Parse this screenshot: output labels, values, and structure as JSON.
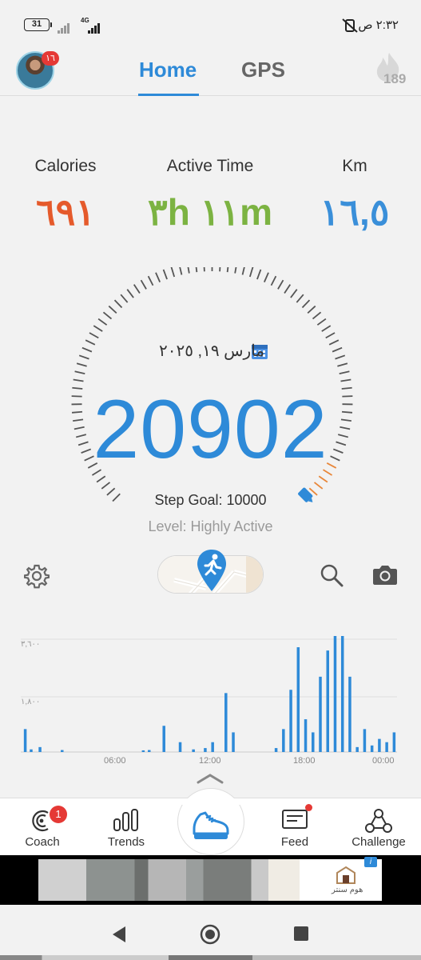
{
  "status_bar": {
    "battery": "31",
    "network": "4G",
    "time": "٢:٣٢ ص"
  },
  "header": {
    "avatar_badge": "١٦",
    "tabs": [
      {
        "label": "Home",
        "active": true
      },
      {
        "label": "GPS",
        "active": false
      }
    ],
    "streak_count": "189"
  },
  "stats": {
    "calories": {
      "label": "Calories",
      "value": "٦٩١",
      "color": "#e55a2b"
    },
    "active_time": {
      "label": "Active Time",
      "value": "٣h ١١m",
      "color": "#7cb342"
    },
    "km": {
      "label": "Km",
      "value": "١٦,٥",
      "color": "#3a8fd9"
    }
  },
  "gauge": {
    "date": "مارس ١٩, ٢٠٢٥",
    "steps": "20902",
    "step_goal": "Step Goal: 10000",
    "level": "Level: Highly Active",
    "progress_fraction": 1.0,
    "accent_color": "#2e8ad8",
    "tick_color": "#555555",
    "end_tick_color": "#e8873a"
  },
  "chart_data": {
    "type": "bar",
    "y_ticks": [
      "٣,٦٠٠",
      "١,٨٠٠"
    ],
    "x_ticks": [
      "06:00",
      "12:00",
      "18:00",
      "00:00"
    ],
    "ylim": [
      0,
      3600
    ],
    "color": "#2e8ad8",
    "values": [
      700,
      80,
      150,
      0,
      0,
      60,
      0,
      0,
      0,
      0,
      0,
      0,
      0,
      0,
      0,
      0,
      0,
      50,
      60,
      0,
      0,
      0,
      0,
      0,
      0,
      0,
      0,
      0,
      0,
      0,
      0,
      0,
      0,
      0,
      0,
      0,
      0,
      0,
      0,
      0,
      0,
      0,
      0,
      0,
      0,
      0,
      0,
      0,
      0,
      0,
      0,
      0,
      0,
      0,
      0,
      0,
      0,
      0,
      0,
      0,
      0,
      0,
      0,
      0,
      0,
      0,
      0,
      0,
      0,
      0,
      0,
      0,
      0,
      0,
      0,
      0,
      0,
      0,
      0,
      0,
      0,
      0,
      0,
      0,
      0,
      0,
      0,
      0,
      0,
      0,
      0,
      0,
      0,
      0,
      0,
      0,
      0,
      0,
      0,
      0,
      0,
      0,
      0,
      0,
      0,
      0,
      0,
      0,
      0,
      0,
      0,
      0,
      0,
      0,
      0,
      0,
      0,
      0,
      0,
      0,
      0,
      0,
      0,
      0,
      0,
      0,
      0,
      0,
      0,
      0,
      0,
      0,
      0,
      0,
      0,
      0,
      0,
      0,
      0,
      0,
      0,
      0,
      0,
      0,
      0,
      0,
      0,
      0,
      0,
      80,
      0,
      0,
      0,
      0,
      0,
      0,
      0,
      0,
      0,
      0,
      0,
      0,
      0,
      0,
      0,
      0,
      0,
      0,
      0,
      0,
      0,
      0,
      0,
      0,
      0,
      0,
      0,
      0,
      0,
      0,
      0,
      0,
      0,
      0,
      0,
      0,
      0,
      0,
      0,
      0,
      0,
      0,
      0,
      0,
      0,
      0,
      0,
      0,
      0,
      0,
      0,
      0,
      0,
      0,
      0,
      0,
      0,
      0,
      0,
      0,
      0,
      0
    ],
    "bars": [
      {
        "x": 0.2,
        "v": 700
      },
      {
        "x": 1.0,
        "v": 80
      },
      {
        "x": 2.2,
        "v": 150
      },
      {
        "x": 5.2,
        "v": 60
      },
      {
        "x": 16.2,
        "v": 50
      },
      {
        "x": 17.0,
        "v": 60
      },
      {
        "x": 19.0,
        "v": 800
      },
      {
        "x": 21.2,
        "v": 300
      },
      {
        "x": 23.0,
        "v": 80
      },
      {
        "x": 24.6,
        "v": 120
      },
      {
        "x": 25.6,
        "v": 300
      },
      {
        "x": 27.4,
        "v": 1800
      },
      {
        "x": 28.4,
        "v": 600
      },
      {
        "x": 34.2,
        "v": 120
      },
      {
        "x": 35.2,
        "v": 700
      },
      {
        "x": 36.2,
        "v": 1900
      },
      {
        "x": 37.2,
        "v": 3200
      },
      {
        "x": 38.2,
        "v": 1000
      },
      {
        "x": 39.2,
        "v": 600
      },
      {
        "x": 40.2,
        "v": 2300
      },
      {
        "x": 41.2,
        "v": 3100
      },
      {
        "x": 42.2,
        "v": 3900
      },
      {
        "x": 43.2,
        "v": 3800
      },
      {
        "x": 44.2,
        "v": 2300
      },
      {
        "x": 45.2,
        "v": 150
      },
      {
        "x": 46.2,
        "v": 700
      },
      {
        "x": 47.2,
        "v": 200
      },
      {
        "x": 48.2,
        "v": 400
      },
      {
        "x": 49.2,
        "v": 300
      },
      {
        "x": 50.2,
        "v": 600
      }
    ]
  },
  "bottom_nav": {
    "items": [
      {
        "label": "Coach",
        "badge": "1"
      },
      {
        "label": "Trends"
      },
      {
        "label": "Feed"
      },
      {
        "label": "Challenge"
      }
    ]
  },
  "ad": {
    "brand_text": "هوم سنتر",
    "info_label": "i"
  }
}
